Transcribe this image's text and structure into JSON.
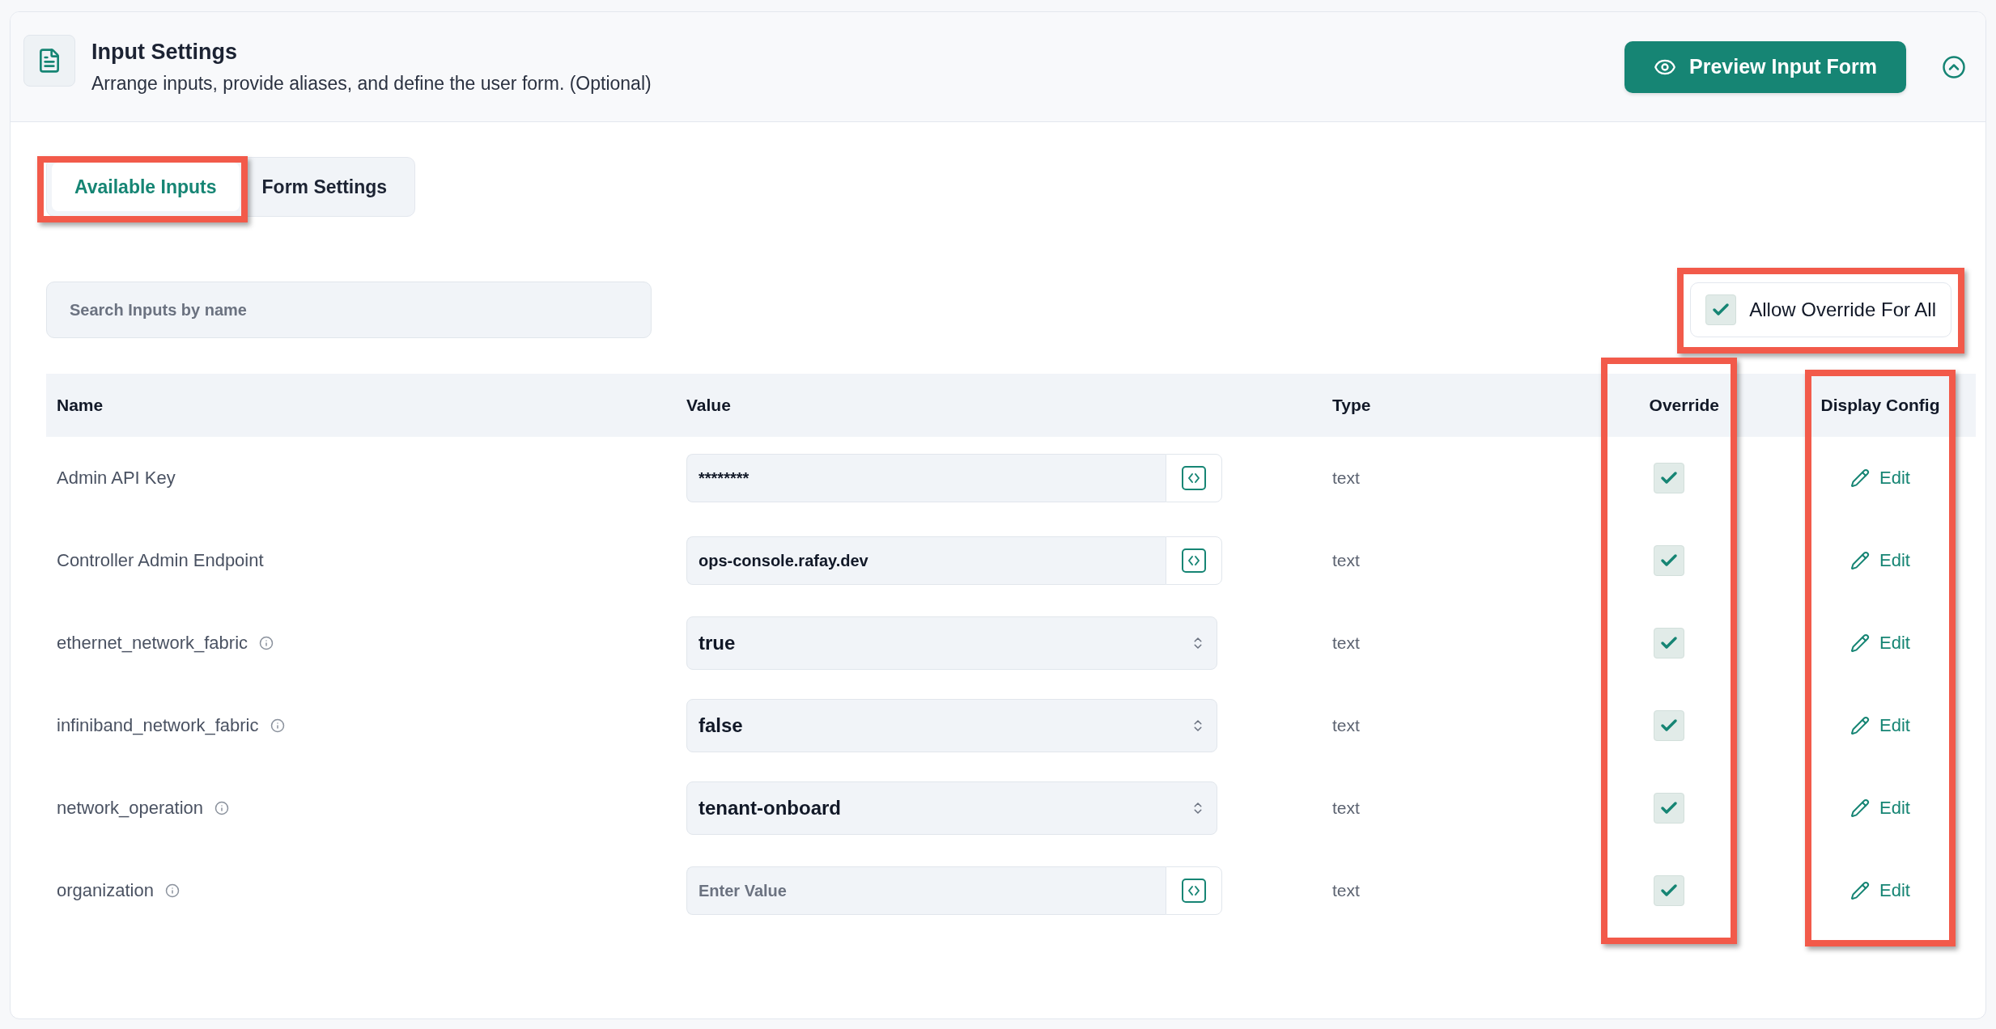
{
  "section": {
    "title": "Input Settings",
    "subtitle": "Arrange inputs, provide aliases, and define the user form. (Optional)",
    "preview_button": "Preview Input Form",
    "expanded": true
  },
  "tabs": [
    {
      "label": "Available Inputs",
      "selected": true,
      "highlighted": true
    },
    {
      "label": "Form Settings",
      "selected": false,
      "highlighted": false
    }
  ],
  "search": {
    "placeholder": "Search Inputs by name"
  },
  "allow_override_all": {
    "label": "Allow Override For All",
    "checked": true,
    "highlighted": true
  },
  "table": {
    "columns": [
      {
        "label": "Name",
        "highlighted": false
      },
      {
        "label": "Value",
        "highlighted": false
      },
      {
        "label": "Type",
        "highlighted": false
      },
      {
        "label": "Override",
        "highlighted": true
      },
      {
        "label": "Display Config",
        "highlighted": true
      }
    ],
    "rows": [
      {
        "name": "Admin API Key",
        "info": false,
        "kind": "input",
        "value": "********",
        "type": "text",
        "override": true,
        "action": "Edit"
      },
      {
        "name": "Controller Admin Endpoint",
        "info": false,
        "kind": "input",
        "value": "ops-console.rafay.dev",
        "type": "text",
        "override": true,
        "action": "Edit"
      },
      {
        "name": "ethernet_network_fabric",
        "info": true,
        "kind": "select",
        "value": "true",
        "type": "text",
        "override": true,
        "action": "Edit"
      },
      {
        "name": "infiniband_network_fabric",
        "info": true,
        "kind": "select",
        "value": "false",
        "type": "text",
        "override": true,
        "action": "Edit"
      },
      {
        "name": "network_operation",
        "info": true,
        "kind": "select",
        "value": "tenant-onboard",
        "type": "text",
        "override": true,
        "action": "Edit"
      },
      {
        "name": "organization",
        "info": true,
        "kind": "input",
        "placeholder": "Enter Value",
        "type": "text",
        "override": true,
        "action": "Edit"
      }
    ]
  }
}
